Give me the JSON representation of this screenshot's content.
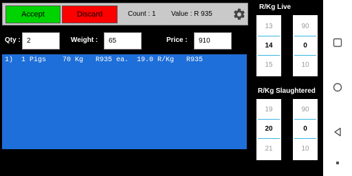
{
  "toolbar": {
    "accept_label": "Accept",
    "discard_label": "Discard",
    "count_text": "Count : 1",
    "value_text": "Value : R 935",
    "settings_icon": "gear-icon"
  },
  "form": {
    "qty_label": "Qty :",
    "qty_value": "2",
    "weight_label": "Weight :",
    "weight_value": "65",
    "price_label": "Price :",
    "price_value": "910"
  },
  "list": {
    "items": [
      "1)  1 Pigs    70 Kg   R935 ea.  19.0 R/Kg   R935"
    ]
  },
  "live": {
    "title": "R/Kg Live",
    "left": [
      "13",
      "14",
      "15"
    ],
    "right": [
      "90",
      "0",
      "10"
    ]
  },
  "slaughtered": {
    "title": "R/Kg Slaughtered",
    "left": [
      "19",
      "20",
      "21"
    ],
    "right": [
      "90",
      "0",
      "10"
    ]
  },
  "navbar": {
    "icons": [
      "recent-apps-icon",
      "home-icon",
      "back-icon",
      "menu-dot-icon"
    ]
  },
  "colors": {
    "accept": "#00d400",
    "discard": "#ff0000",
    "list_bg": "#1e6fd9",
    "spinner_divider": "#37b4e0"
  }
}
